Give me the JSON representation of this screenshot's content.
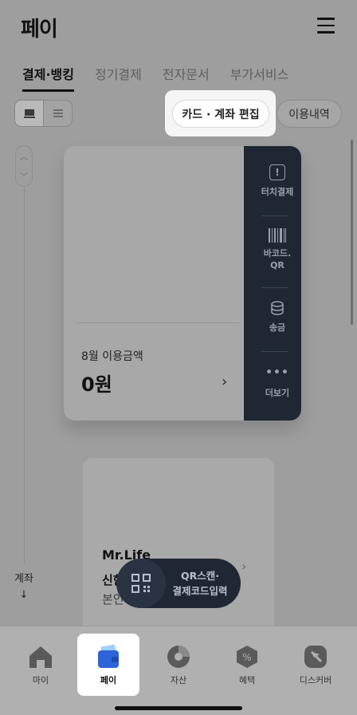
{
  "header": {
    "title": "페이",
    "menu_icon": "hamburger-menu-icon"
  },
  "tabs": [
    {
      "label": "결제·뱅킹",
      "active": true
    },
    {
      "label": "정기결제",
      "active": false
    },
    {
      "label": "전자문서",
      "active": false
    },
    {
      "label": "부가서비스",
      "active": false
    }
  ],
  "toolbar": {
    "edit_label": "카드 · 계좌 편집",
    "history_label": "이용내역"
  },
  "scroll": {
    "up": "^",
    "down": "v"
  },
  "account_jump": {
    "label": "계좌",
    "arrow": "↓"
  },
  "card": {
    "usage_label": "8월 이용금액",
    "usage_amount": "0원",
    "chevron": "›",
    "side_actions": [
      {
        "label": "터치결제",
        "icon": "exclamation-icon"
      },
      {
        "label": "바코드.\nQR",
        "icon": "barcode-icon"
      },
      {
        "label": "송금",
        "icon": "coin-stack-icon"
      },
      {
        "label": "더보기",
        "icon": "more-dots-icon"
      }
    ]
  },
  "account_card": {
    "name": "Mr.Life",
    "bank": "신한",
    "owner": "본인",
    "chevron": "›"
  },
  "qr_button": {
    "line1": "QR스캔·",
    "line2": "결제코드입력"
  },
  "bottom_nav": [
    {
      "label": "마이",
      "icon": "home-icon",
      "active": false
    },
    {
      "label": "페이",
      "icon": "wallet-icon",
      "active": true
    },
    {
      "label": "자산",
      "icon": "pie-chart-icon",
      "active": false
    },
    {
      "label": "혜택",
      "icon": "benefit-icon",
      "active": false
    },
    {
      "label": "디스커버",
      "icon": "compass-icon",
      "active": false
    }
  ],
  "colors": {
    "accent_dark": "#1f2734",
    "dim_overlay": "#9e9e9e",
    "wallet_blue": "#2f63d8"
  }
}
